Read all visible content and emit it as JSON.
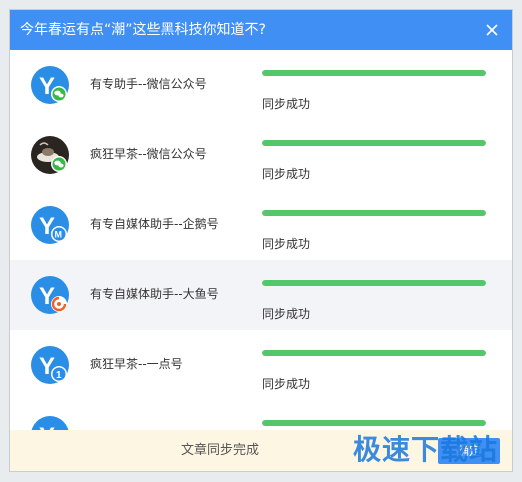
{
  "dialog": {
    "title": "今年春运有点“潮”这些黑科技你知道不?",
    "close_icon": "close-icon"
  },
  "accounts": [
    {
      "name": "有专助手--微信公众号",
      "status": "同步成功",
      "progress": 1.0,
      "badge": "wechat",
      "avatar": "youzhuan-logo",
      "highlight": false
    },
    {
      "name": "疯狂早茶--微信公众号",
      "status": "同步成功",
      "progress": 1.0,
      "badge": "wechat",
      "avatar": "tea-photo",
      "highlight": false
    },
    {
      "name": "有专自媒体助手--企鹅号",
      "status": "同步成功",
      "progress": 1.0,
      "badge": "penguin",
      "avatar": "youzhuan-logo",
      "highlight": false
    },
    {
      "name": "有专自媒体助手--大鱼号",
      "status": "同步成功",
      "progress": 1.0,
      "badge": "dayu",
      "avatar": "youzhuan-logo",
      "highlight": true
    },
    {
      "name": "疯狂早茶--一点号",
      "status": "同步成功",
      "progress": 1.0,
      "badge": "yidian",
      "avatar": "youzhuan-logo",
      "highlight": false
    },
    {
      "name": "",
      "status": "",
      "progress": 1.0,
      "badge": "",
      "avatar": "youzhuan-logo",
      "highlight": false
    }
  ],
  "footer": {
    "message": "文章同步完成",
    "button_label": "确定",
    "watermark": "极速下载站"
  },
  "colors": {
    "title_bar": "#3f8ff5",
    "progress_fill": "#55c76b",
    "footer_bg": "#fdf6e3",
    "highlight_row": "#f3f4f7"
  }
}
